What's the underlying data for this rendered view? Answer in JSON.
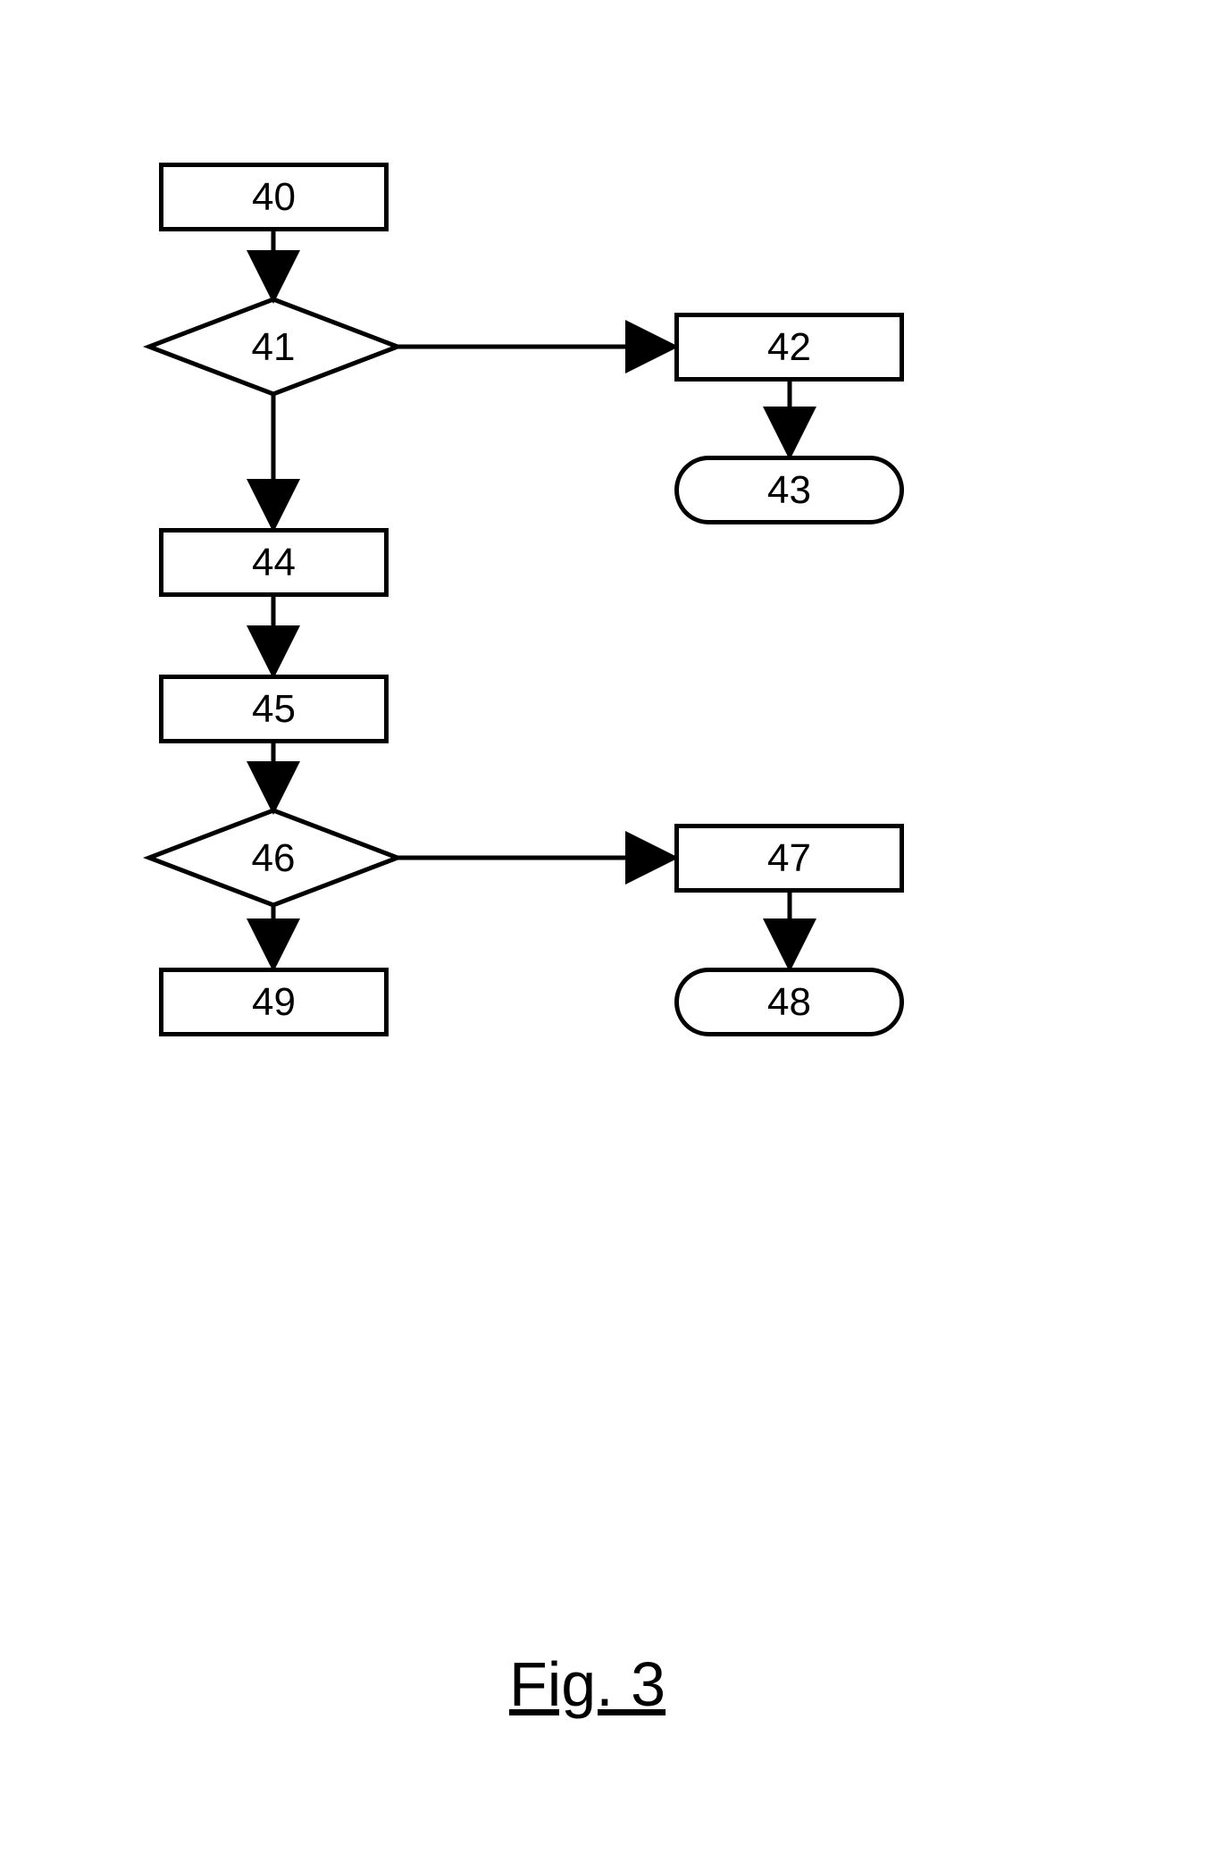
{
  "nodes": {
    "n40": "40",
    "n41": "41",
    "n42": "42",
    "n43": "43",
    "n44": "44",
    "n45": "45",
    "n46": "46",
    "n47": "47",
    "n48": "48",
    "n49": "49"
  },
  "caption": "Fig. 3"
}
